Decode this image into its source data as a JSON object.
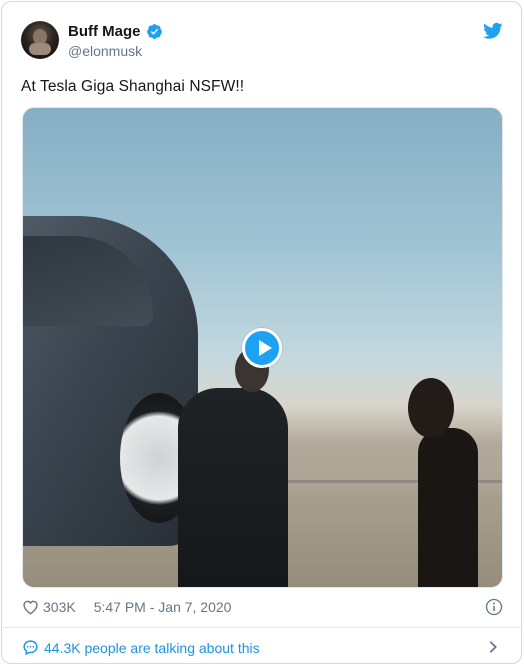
{
  "author": {
    "display_name": "Buff Mage",
    "handle": "@elonmusk",
    "verified": true
  },
  "tweet": {
    "text": "At Tesla Giga Shanghai NSFW!!",
    "media_type": "video"
  },
  "stats": {
    "likes": "303K",
    "timestamp": "5:47 PM - Jan 7, 2020"
  },
  "conversation": {
    "label": "44.3K people are talking about this"
  },
  "icons": {
    "brand": "twitter-bird-icon",
    "verified": "verified-badge-icon",
    "like": "heart-icon",
    "info": "info-icon",
    "conversation": "speech-bubble-icon",
    "more": "chevron-right-icon",
    "play": "play-icon"
  },
  "colors": {
    "accent": "#1da1f2",
    "link": "#1b95e0",
    "muted": "#657786",
    "text": "#14171a",
    "border": "#e1e8ed"
  }
}
